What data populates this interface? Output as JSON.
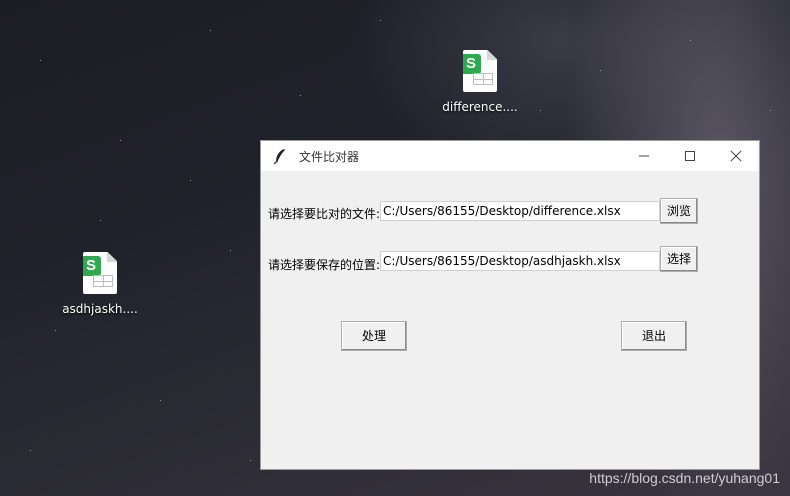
{
  "desktop": {
    "icons": [
      {
        "label": "difference...."
      },
      {
        "label": "asdhjaskh...."
      }
    ],
    "watermark": "https://blog.csdn.net/yuhang01"
  },
  "window": {
    "title": "文件比对器",
    "icon": "feather-icon",
    "controls": [
      "minimize-icon",
      "maximize-icon",
      "close-icon"
    ],
    "form": {
      "file_label": "请选择要比对的文件:",
      "file_value": "C:/Users/86155/Desktop/difference.xlsx",
      "browse_button": "浏览",
      "save_label": "请选择要保存的位置:",
      "save_value": "C:/Users/86155/Desktop/asdhjaskh.xlsx",
      "select_button": "选择",
      "process_button": "处理",
      "exit_button": "退出"
    }
  },
  "colors": {
    "badge_green": "#2fa94d",
    "window_bg": "#f0f0f0"
  }
}
